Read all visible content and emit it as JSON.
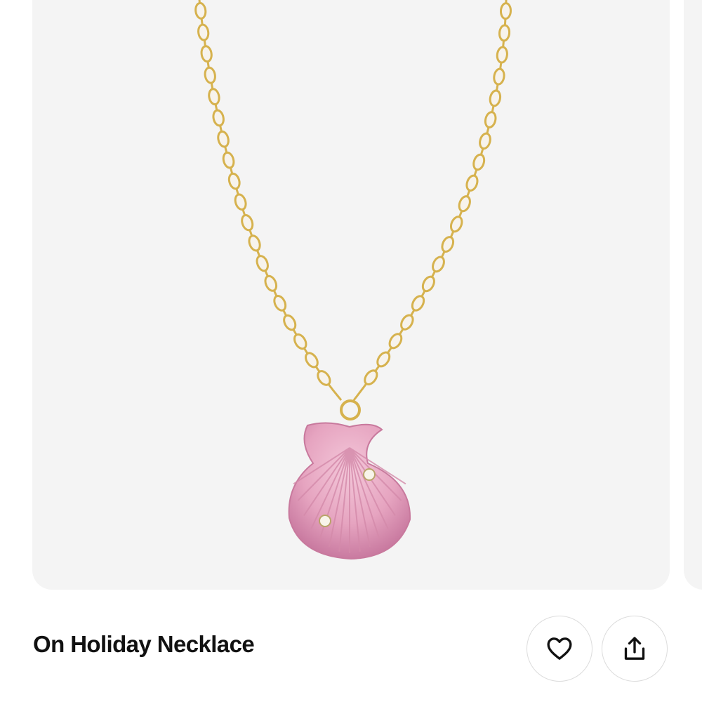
{
  "product": {
    "title": "On Holiday Necklace",
    "image_alt": "Gold chain necklace with pink scallop shell pendant"
  },
  "actions": {
    "favorite_icon": "heart-icon",
    "share_icon": "share-icon"
  },
  "colors": {
    "card_background": "#f4f4f4",
    "chain_gold": "#d6b24e",
    "shell_pink": "#e8a9c4",
    "text": "#111111"
  }
}
